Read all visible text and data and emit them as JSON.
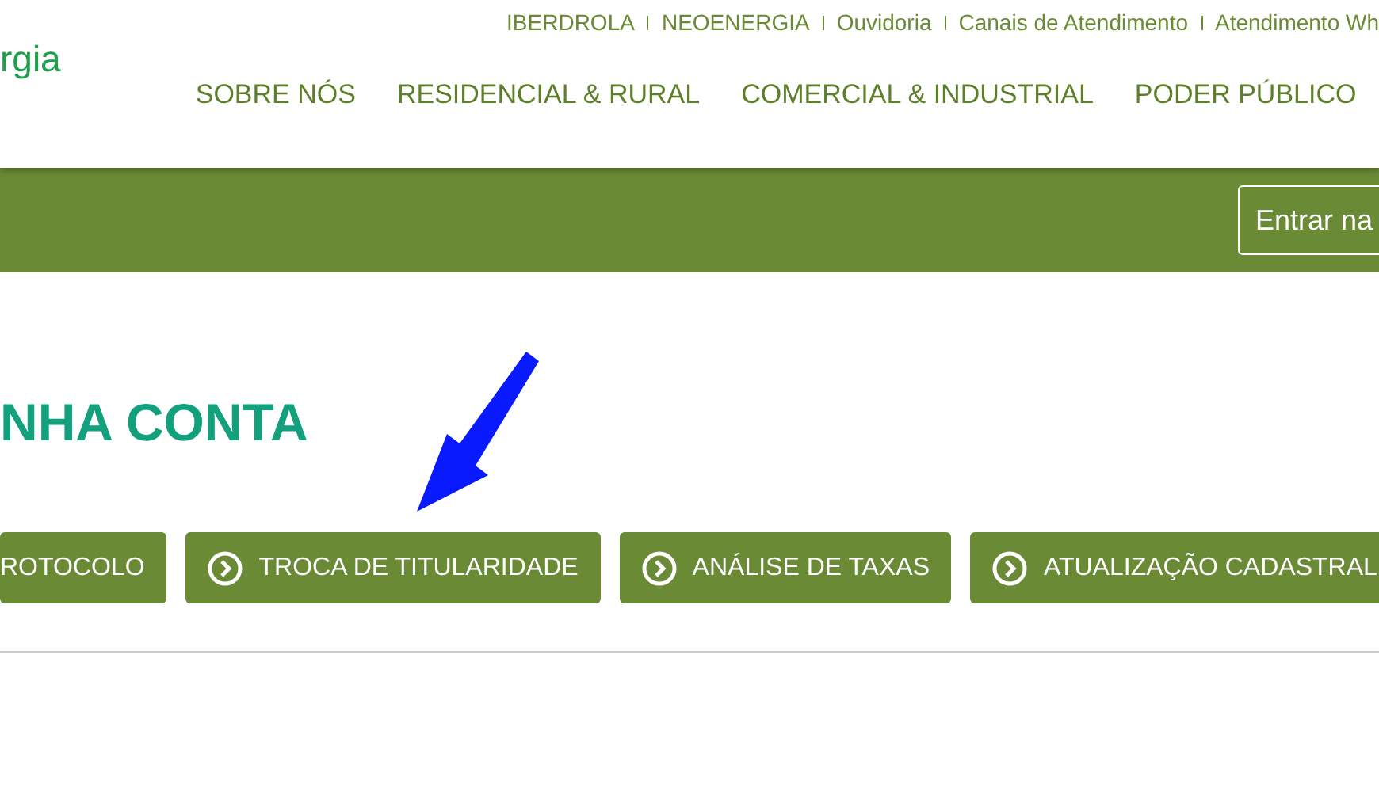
{
  "top_links": [
    "IBERDROLA",
    "NEOENERGIA",
    "Ouvidoria",
    "Canais de Atendimento",
    "Atendimento Wh"
  ],
  "logo": "rgia",
  "nav": [
    "SOBRE NÓS",
    "RESIDENCIAL & RURAL",
    "COMERCIAL & INDUSTRIAL",
    "PODER PÚBLICO"
  ],
  "login_button": "Entrar na",
  "title": "NHA CONTA",
  "actions": [
    {
      "label": "ROTOCOLO",
      "kind": "plain"
    },
    {
      "label": "TROCA DE TITULARIDADE",
      "kind": "icon"
    },
    {
      "label": "ANÁLISE DE TAXAS",
      "kind": "icon"
    },
    {
      "label": "ATUALIZAÇÃO CADASTRAL",
      "kind": "icon"
    }
  ]
}
